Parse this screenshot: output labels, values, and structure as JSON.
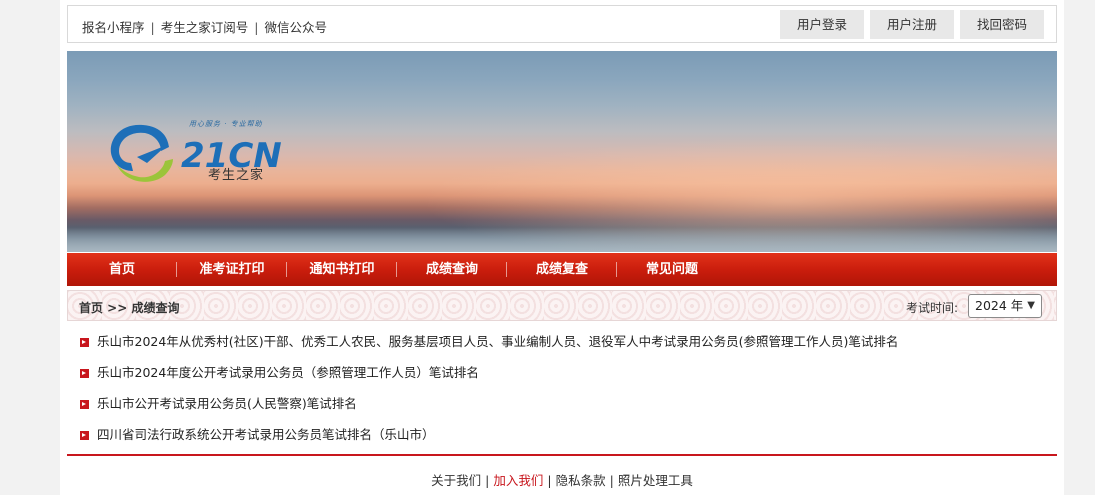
{
  "topbar": {
    "links": [
      "报名小程序",
      "考生之家订阅号",
      "微信公众号"
    ],
    "separator": "|",
    "buttons": {
      "login": "用户登录",
      "register": "用户注册",
      "recover": "找回密码"
    }
  },
  "banner": {
    "logo_brand": "21CN",
    "logo_slogan": "用心服务 · 专业帮助",
    "logo_name": "考生之家"
  },
  "nav": {
    "items": [
      "首页",
      "准考证打印",
      "通知书打印",
      "成绩查询",
      "成绩复查",
      "常见问题"
    ]
  },
  "breadcrumb": {
    "path": "首页 >> 成绩查询",
    "exam_time_label": "考试时间:",
    "year_selected": "2024 年"
  },
  "list": {
    "items": [
      "乐山市2024年从优秀村(社区)干部、优秀工人农民、服务基层项目人员、事业编制人员、退役军人中考试录用公务员(参照管理工作人员)笔试排名",
      "乐山市2024年度公开考试录用公务员（参照管理工作人员）笔试排名",
      "乐山市公开考试录用公务员(人民警察)笔试排名",
      "四川省司法行政系统公开考试录用公务员笔试排名（乐山市）"
    ]
  },
  "footer": {
    "about": "关于我们",
    "join": "加入我们",
    "privacy": "隐私条款",
    "photo_tool": "照片处理工具",
    "separator": "|"
  },
  "colors": {
    "accent_red": "#c8161d",
    "nav_red": "#d02612",
    "button_gray": "#e8e8e8"
  }
}
